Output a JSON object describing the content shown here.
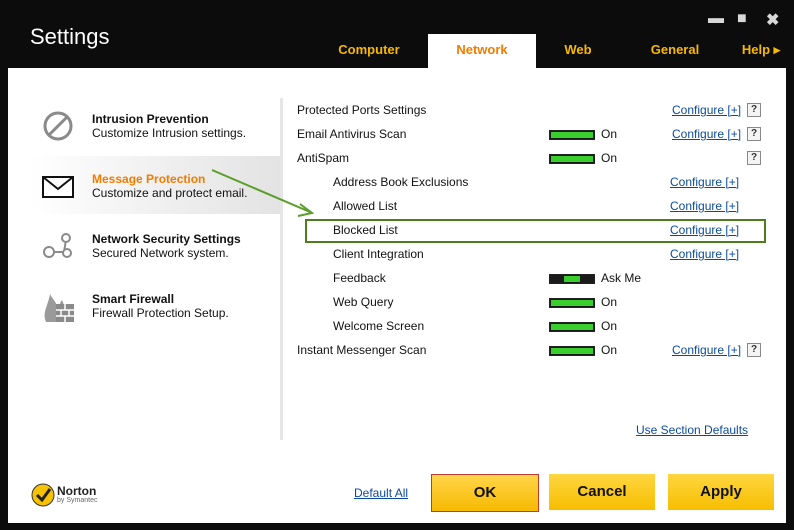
{
  "window": {
    "title": "Settings",
    "minimize_glyph": "▬",
    "maximize_glyph": "■",
    "close_glyph": "✖"
  },
  "tabs": [
    {
      "label": "Computer"
    },
    {
      "label": "Network"
    },
    {
      "label": "Web"
    },
    {
      "label": "General"
    },
    {
      "label": "Help ▸"
    }
  ],
  "sidebar": {
    "items": [
      {
        "title": "Intrusion Prevention",
        "subtitle": "Customize Intrusion settings.",
        "icon": "no-entry-icon"
      },
      {
        "title": "Message Protection",
        "subtitle": "Customize and protect email.",
        "icon": "envelope-icon"
      },
      {
        "title": "Network Security Settings",
        "subtitle": "Secured Network system.",
        "icon": "network-nodes-icon"
      },
      {
        "title": "Smart Firewall",
        "subtitle": "Firewall Protection Setup.",
        "icon": "firewall-icon"
      }
    ]
  },
  "settings": {
    "rows": [
      {
        "label": "Protected Ports Settings",
        "configure": "Configure [+]",
        "help": "?"
      },
      {
        "label": "Email Antivirus Scan",
        "state": "On",
        "configure": "Configure [+]",
        "help": "?"
      },
      {
        "label": "AntiSpam",
        "state": "On",
        "help": "?"
      },
      {
        "label": "Address Book Exclusions",
        "configure": "Configure [+]"
      },
      {
        "label": "Allowed List",
        "configure": "Configure [+]"
      },
      {
        "label": "Blocked List",
        "configure": "Configure [+]"
      },
      {
        "label": "Client Integration",
        "configure": "Configure [+]"
      },
      {
        "label": "Feedback",
        "state": "Ask Me"
      },
      {
        "label": "Web Query",
        "state": "On"
      },
      {
        "label": "Welcome Screen",
        "state": "On"
      },
      {
        "label": "Instant Messenger Scan",
        "state": "On",
        "configure": "Configure [+]",
        "help": "?"
      }
    ],
    "use_section_defaults": "Use Section Defaults"
  },
  "footer": {
    "logo_name": "Norton",
    "logo_sub": "by Symantec",
    "default_all": "Default All",
    "ok": "OK",
    "cancel": "Cancel",
    "apply": "Apply"
  },
  "colors": {
    "accent_orange": "#f07c00",
    "tab_yellow": "#f7b800",
    "toggle_green": "#3acd2e",
    "link_blue": "#0b4a9e",
    "highlight_green": "#4e7d1e"
  }
}
